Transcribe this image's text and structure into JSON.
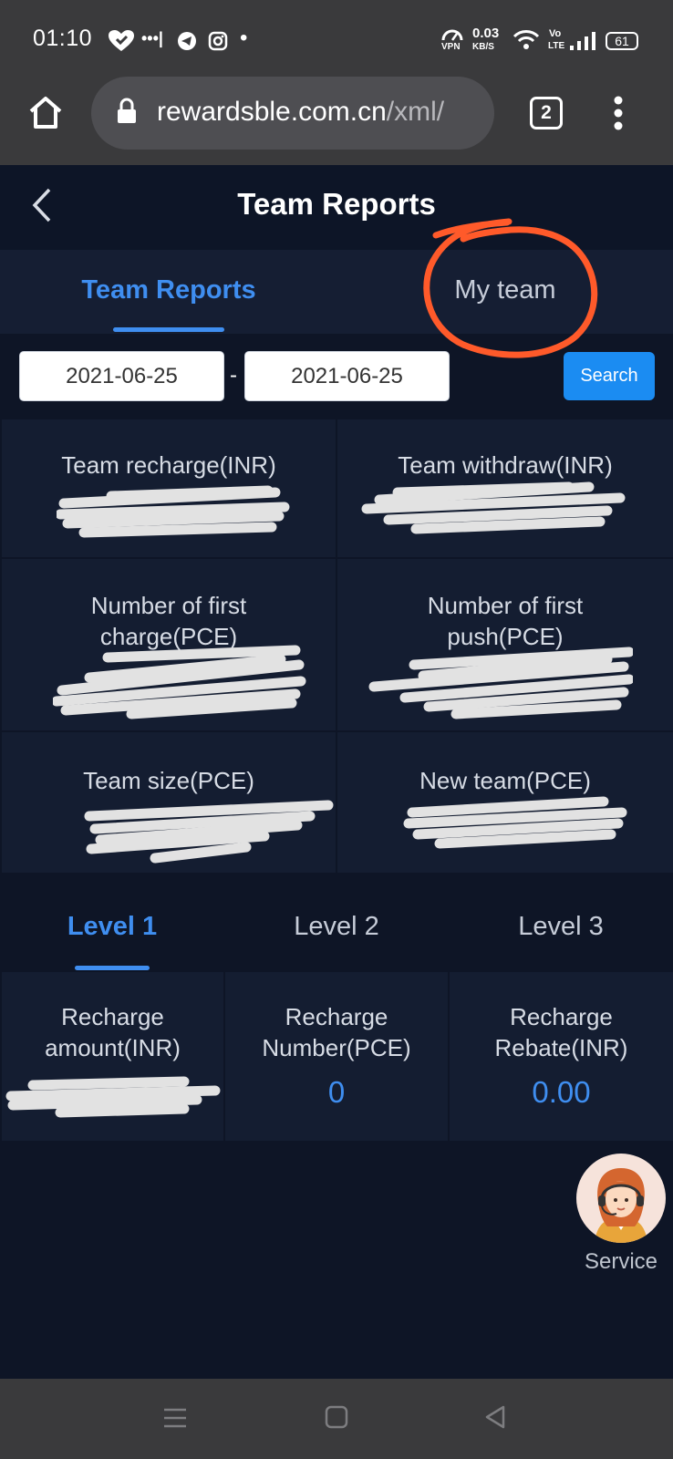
{
  "status_bar": {
    "time": "01:10",
    "net_speed_value": "0.03",
    "net_speed_unit": "KB/S",
    "vpn": "VPN",
    "volte_top": "Vo",
    "volte_bottom": "LTE",
    "battery": "61"
  },
  "browser": {
    "url_host": "rewardsble.com.cn",
    "url_path": "/xml/",
    "tabs_count": "2"
  },
  "header": {
    "title": "Team Reports"
  },
  "top_tabs": [
    {
      "label": "Team Reports",
      "active": true
    },
    {
      "label": "My team",
      "active": false
    }
  ],
  "filter": {
    "start_date": "2021-06-25",
    "separator": "-",
    "end_date": "2021-06-25",
    "search_label": "Search"
  },
  "stats": [
    {
      "label_line1": "Team recharge(INR)",
      "label_line2": ""
    },
    {
      "label_line1": "Team withdraw(INR)",
      "label_line2": ""
    },
    {
      "label_line1": "Number of first",
      "label_line2": "charge(PCE)"
    },
    {
      "label_line1": "Number of first",
      "label_line2": "push(PCE)"
    },
    {
      "label_line1": "Team size(PCE)",
      "label_line2": ""
    },
    {
      "label_line1": "New team(PCE)",
      "label_line2": ""
    }
  ],
  "level_tabs": [
    {
      "label": "Level 1",
      "active": true
    },
    {
      "label": "Level 2",
      "active": false
    },
    {
      "label": "Level 3",
      "active": false
    }
  ],
  "level_metrics": [
    {
      "label_line1": "Recharge",
      "label_line2": "amount(INR)",
      "value": ""
    },
    {
      "label_line1": "Recharge",
      "label_line2": "Number(PCE)",
      "value": "0"
    },
    {
      "label_line1": "Recharge",
      "label_line2": "Rebate(INR)",
      "value": "0.00"
    }
  ],
  "service": {
    "label": "Service"
  },
  "colors": {
    "accent": "#3f8ef0",
    "annotation": "#ff5a2a",
    "page_bg": "#0e1526"
  }
}
